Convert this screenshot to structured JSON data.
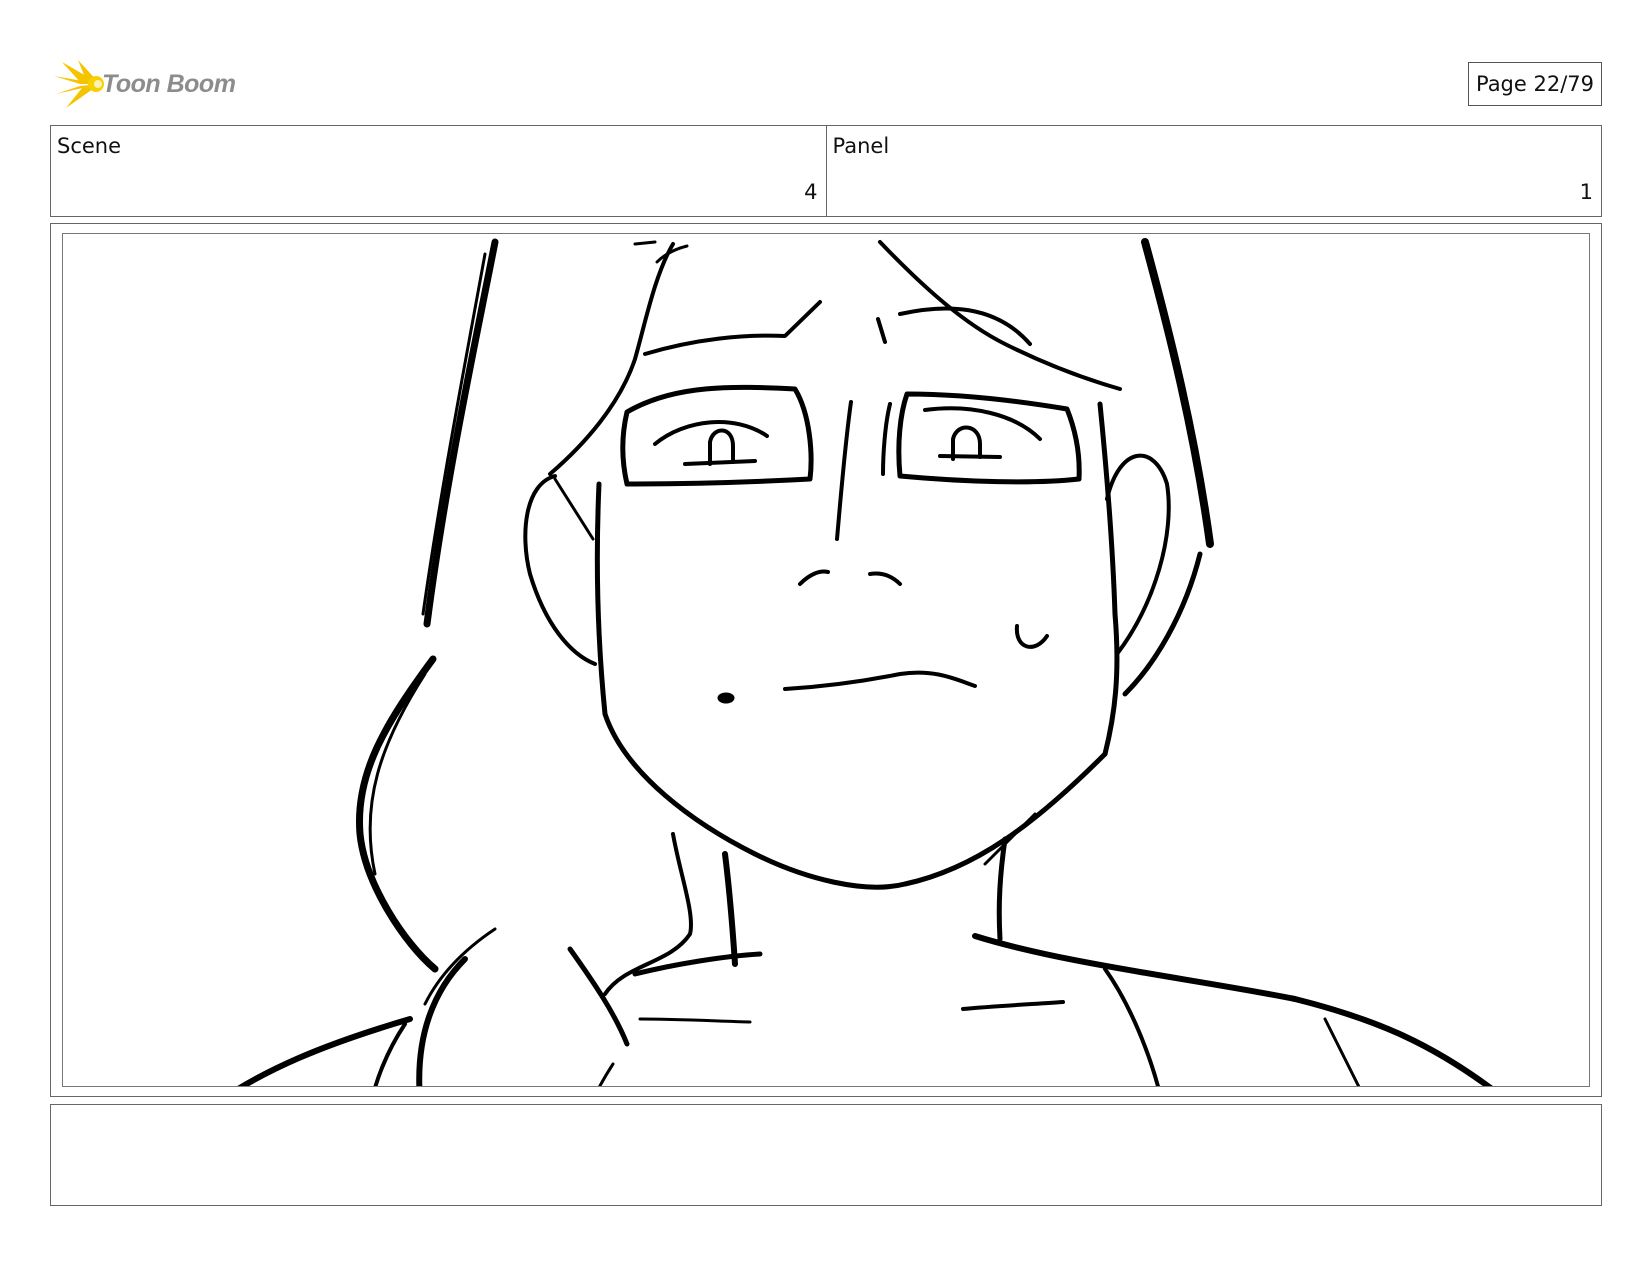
{
  "header": {
    "logo_text": "Toon Boom",
    "logo_color": "#f5c400",
    "page_label": "Page 22/79"
  },
  "info": {
    "scene_label": "Scene",
    "scene_value": "4",
    "panel_label": "Panel",
    "panel_value": "1"
  },
  "panel": {
    "image": "sketch of a sweating character with glasses looking up nervously"
  },
  "notes": {
    "text": ""
  }
}
